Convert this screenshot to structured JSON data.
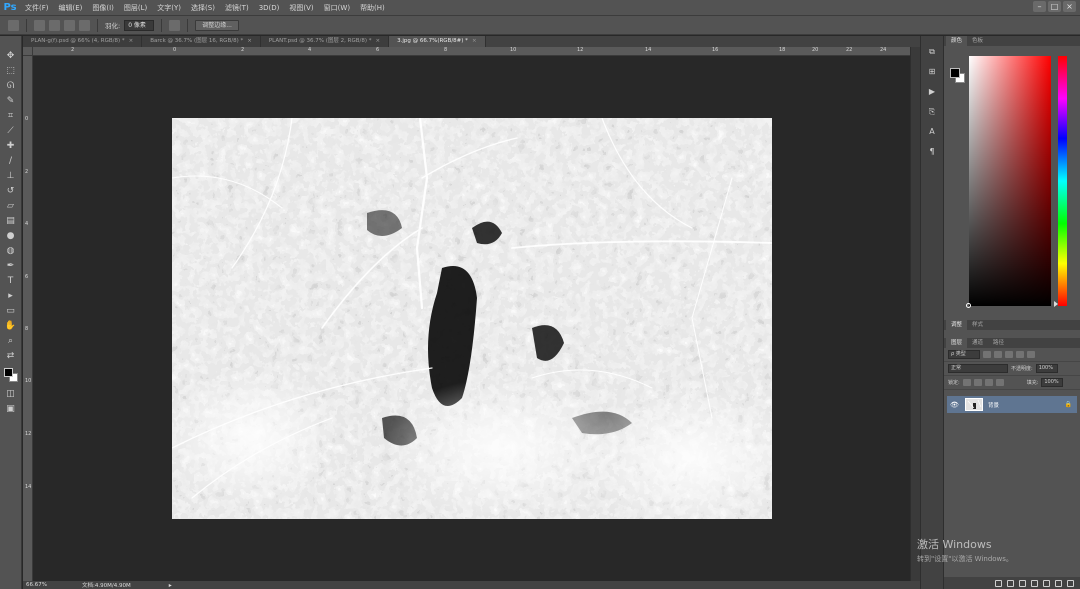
{
  "app": {
    "logo": "Ps",
    "menu": [
      "文件(F)",
      "编辑(E)",
      "图像(I)",
      "图层(L)",
      "文字(Y)",
      "选择(S)",
      "滤镜(T)",
      "3D(D)",
      "视图(V)",
      "窗口(W)",
      "帮助(H)"
    ],
    "window_controls": [
      "–",
      "□",
      "×"
    ]
  },
  "options_bar": {
    "feather_label": "羽化:",
    "feather_value": "0 像素",
    "refine_button": "调整边缘..."
  },
  "tabs": [
    {
      "label": "PLAN-g(f).psd @ 66% (4, RGB/8) *",
      "active": false
    },
    {
      "label": "Barck @ 36.7% (图层 16, RGB/8) *",
      "active": false
    },
    {
      "label": "PLANT.psd @ 36.7% (图层 2, RGB/8) *",
      "active": false
    },
    {
      "label": "3.jpg @ 66.7%(RGB/8#) *",
      "active": true
    }
  ],
  "rulers": {
    "h": [
      "2",
      "0",
      "2",
      "4",
      "6",
      "8",
      "10",
      "12",
      "14",
      "16",
      "18",
      "20",
      "22",
      "24"
    ],
    "v": [
      "0",
      "2",
      "4",
      "6",
      "8",
      "10",
      "12",
      "14"
    ]
  },
  "status": {
    "zoom": "66.67%",
    "doc": "文档:4.90M/4.90M",
    "arrow": "▸"
  },
  "panels": {
    "color_tabs": [
      "颜色",
      "色板"
    ],
    "adjust_tabs": [
      "调整",
      "样式"
    ],
    "adjust_extra": "属性",
    "layers_tabs": [
      "图层",
      "通道",
      "路径"
    ],
    "kind_label": "ρ 类型",
    "blend_mode": "正常",
    "opacity_label": "不透明度:",
    "opacity_value": "100%",
    "lock_label": "锁定:",
    "fill_label": "填充:",
    "fill_value": "100%",
    "layer_name": "背景",
    "colors": {
      "fg": "#000000",
      "bg": "#ffffff"
    }
  },
  "watermark": {
    "title": "激活 Windows",
    "sub": "转到\"设置\"以激活 Windows。"
  }
}
